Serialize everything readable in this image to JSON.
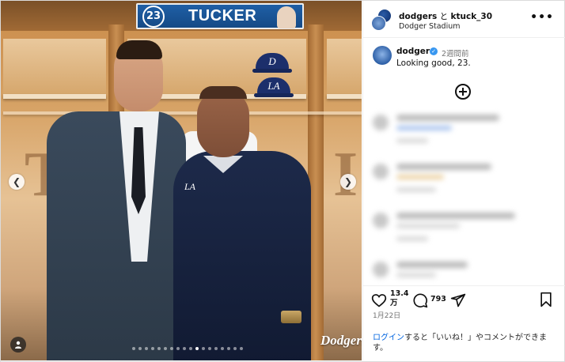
{
  "photo": {
    "nameplate_number": "23",
    "nameplate_name": "TUCKER",
    "cap_letter_1": "D",
    "cap_letter_2": "LA",
    "jacket_logo": "LA",
    "watermark": "Dodgers",
    "dots": {
      "count": 18,
      "active_index": 10
    },
    "locker_letters": [
      "T",
      "I"
    ]
  },
  "header": {
    "user1": "dodgers",
    "connector": "と",
    "user2": "ktuck_30",
    "location": "Dodger Stadium",
    "more_icon": "more-horizontal-icon"
  },
  "caption": {
    "username": "dodgers",
    "verified_icon": "verified-badge-icon",
    "time": "2週間前",
    "text": "Looking good, 23."
  },
  "load_more_icon": "plus-circle-icon",
  "actions": {
    "likes_line1": "13.4",
    "likes_line2": "万",
    "comments": "793",
    "date": "1月22日",
    "login_link": "ログイン",
    "login_rest": "すると「いいね！」やコメントができます。"
  },
  "colors": {
    "link": "#0064e0",
    "verified": "#3897f0",
    "nameplate": "#1f5fa6"
  }
}
